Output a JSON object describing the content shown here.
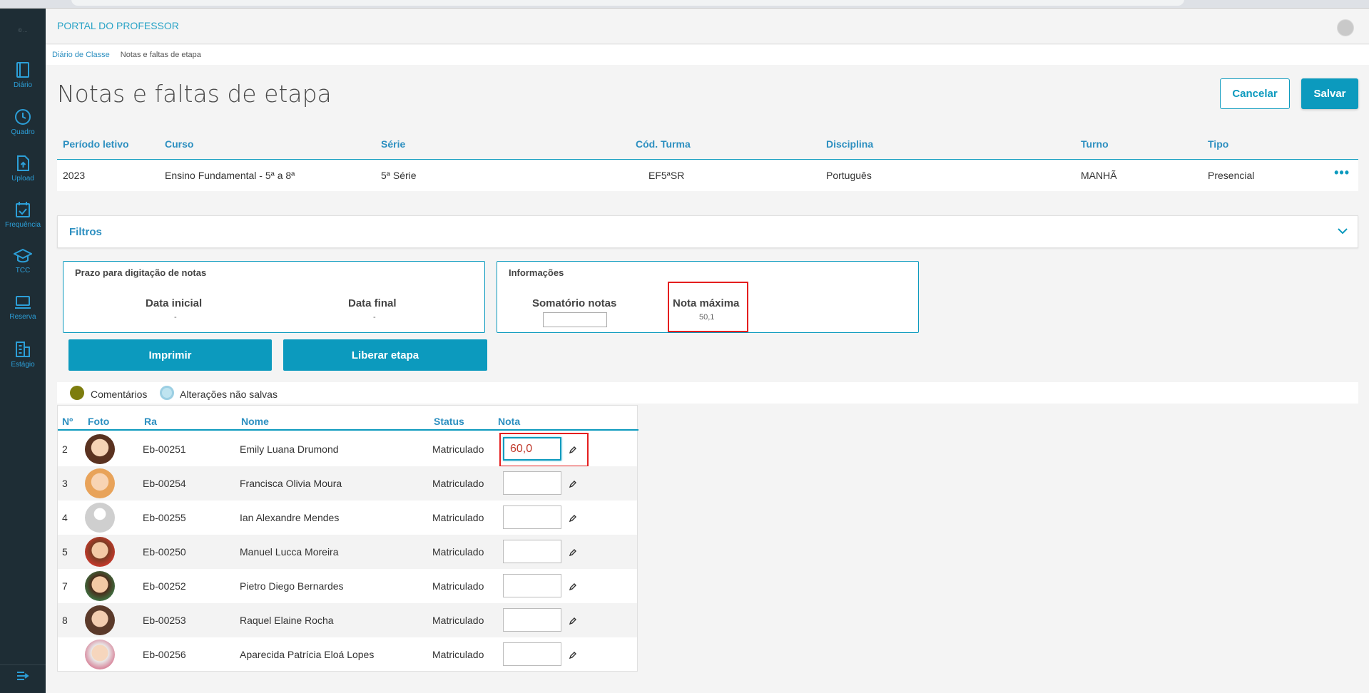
{
  "header": {
    "portal_title": "PORTAL DO PROFESSOR"
  },
  "sidebar": {
    "logo": "© ...",
    "items": [
      {
        "label": "Diário",
        "icon": "book-icon"
      },
      {
        "label": "Quadro",
        "icon": "clock-icon"
      },
      {
        "label": "Upload",
        "icon": "upload-file-icon"
      },
      {
        "label": "Frequência",
        "icon": "calendar-check-icon"
      },
      {
        "label": "TCC",
        "icon": "graduation-cap-icon"
      },
      {
        "label": "Reserva",
        "icon": "laptop-icon"
      },
      {
        "label": "Estágio",
        "icon": "building-icon"
      }
    ]
  },
  "breadcrumb": {
    "parent": "Diário de Classe",
    "current": "Notas e faltas de etapa"
  },
  "page": {
    "title": "Notas e faltas de etapa",
    "cancel_label": "Cancelar",
    "save_label": "Salvar"
  },
  "info": {
    "headers": [
      "Período letivo",
      "Curso",
      "Série",
      "Cód. Turma",
      "Disciplina",
      "Turno",
      "Tipo"
    ],
    "values": [
      "2023",
      "Ensino Fundamental - 5ª a 8ª",
      "5ª Série",
      "EF5ªSR",
      "Português",
      "MANHÃ",
      "Presencial"
    ],
    "more": "•••"
  },
  "filters": {
    "title": "Filtros"
  },
  "prazo": {
    "title": "Prazo para digitação de notas",
    "inicial_label": "Data inicial",
    "inicial_value": "-",
    "final_label": "Data final",
    "final_value": "-"
  },
  "informacoes": {
    "title": "Informações",
    "soma_label": "Somatório notas",
    "max_label": "Nota máxima",
    "max_value": "50,1"
  },
  "actions": {
    "print_label": "Imprimir",
    "release_label": "Liberar etapa"
  },
  "legend": {
    "comments": "Comentários",
    "unsaved": "Alterações não salvas",
    "comments_color": "#7d7d0e",
    "unsaved_color": "#bfe4f0"
  },
  "grid": {
    "headers": [
      "Nº",
      "Foto",
      "Ra",
      "Nome",
      "Status",
      "Nota"
    ],
    "rows": [
      {
        "num": "2",
        "ra": "Eb-00251",
        "nome": "Emily Luana Drumond",
        "status": "Matriculado",
        "nota": "60,0"
      },
      {
        "num": "3",
        "ra": "Eb-00254",
        "nome": "Francisca Olivia Moura",
        "status": "Matriculado",
        "nota": ""
      },
      {
        "num": "4",
        "ra": "Eb-00255",
        "nome": "Ian Alexandre Mendes",
        "status": "Matriculado",
        "nota": ""
      },
      {
        "num": "5",
        "ra": "Eb-00250",
        "nome": "Manuel Lucca Moreira",
        "status": "Matriculado",
        "nota": ""
      },
      {
        "num": "7",
        "ra": "Eb-00252",
        "nome": "Pietro Diego Bernardes",
        "status": "Matriculado",
        "nota": ""
      },
      {
        "num": "8",
        "ra": "Eb-00253",
        "nome": "Raquel Elaine Rocha",
        "status": "Matriculado",
        "nota": ""
      },
      {
        "num": "",
        "ra": "Eb-00256",
        "nome": "Aparecida Patrícia Eloá Lopes",
        "status": "Matriculado",
        "nota": ""
      }
    ]
  }
}
